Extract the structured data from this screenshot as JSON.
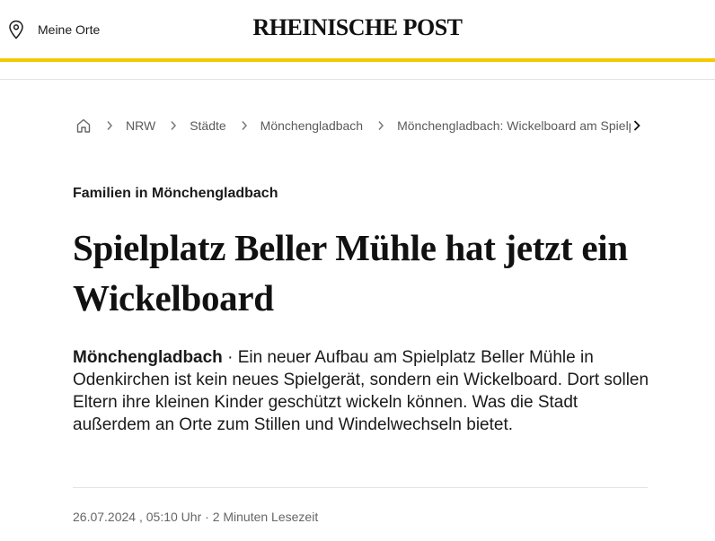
{
  "header": {
    "my_places_label": "Meine Orte",
    "brand": "RHEINISCHE POST",
    "accent_color": "#f6c800"
  },
  "breadcrumb": {
    "home_icon": "home-icon",
    "items": [
      "NRW",
      "Städte",
      "Mönchengladbach",
      "Mönchengladbach: Wickelboard am Spielplatz Beller Mühle"
    ]
  },
  "article": {
    "kicker": "Familien in Mönchengladbach",
    "headline": "Spielplatz Beller Mühle hat jetzt ein Wickelboard",
    "teaser_location": "Mönchengladbach",
    "teaser_separator": " · ",
    "teaser_text": "Ein neuer Aufbau am Spielplatz Beller Mühle in Odenkirchen ist kein neues Spielgerät, sondern ein Wickelboard. Dort sollen Eltern ihre kleinen Kinder geschützt wickeln können. Was die Stadt außerdem an Orte zum Stillen und Windelwechseln bietet.",
    "date": "26.07.2024",
    "time": "05:10 Uhr",
    "reading_time": "2 Minuten Lesezeit"
  }
}
